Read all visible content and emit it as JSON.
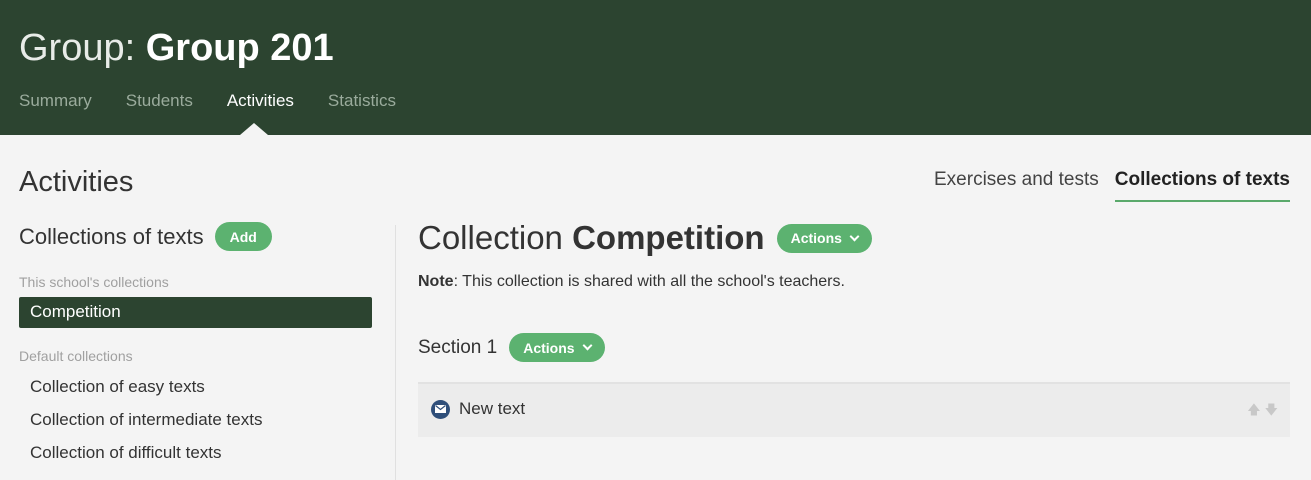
{
  "header": {
    "title_prefix": "Group:",
    "title_name": "Group 201",
    "nav": [
      {
        "label": "Summary"
      },
      {
        "label": "Students"
      },
      {
        "label": "Activities"
      },
      {
        "label": "Statistics"
      }
    ],
    "active_nav": "Activities"
  },
  "page": {
    "title": "Activities",
    "tabs": [
      {
        "label": "Exercises and tests"
      },
      {
        "label": "Collections of texts"
      }
    ],
    "active_tab": "Collections of texts"
  },
  "sidebar": {
    "heading": "Collections of texts",
    "add_label": "Add",
    "school_group_label": "This school's collections",
    "school_items": [
      {
        "label": "Competition"
      }
    ],
    "default_group_label": "Default collections",
    "default_items": [
      {
        "label": "Collection of easy texts"
      },
      {
        "label": "Collection of intermediate texts"
      },
      {
        "label": "Collection of difficult texts"
      }
    ]
  },
  "main": {
    "collection_prefix": "Collection",
    "collection_name": "Competition",
    "actions_label": "Actions",
    "note_bold": "Note",
    "note_text": ": This collection is shared with all the school's teachers.",
    "section": {
      "title": "Section 1",
      "actions_label": "Actions",
      "items": [
        {
          "label": "New text",
          "icon": "envelope-icon"
        }
      ]
    }
  },
  "colors": {
    "header_bg": "#2c4430",
    "accent_green": "#5cb270",
    "selected_bg": "#2c4430"
  }
}
